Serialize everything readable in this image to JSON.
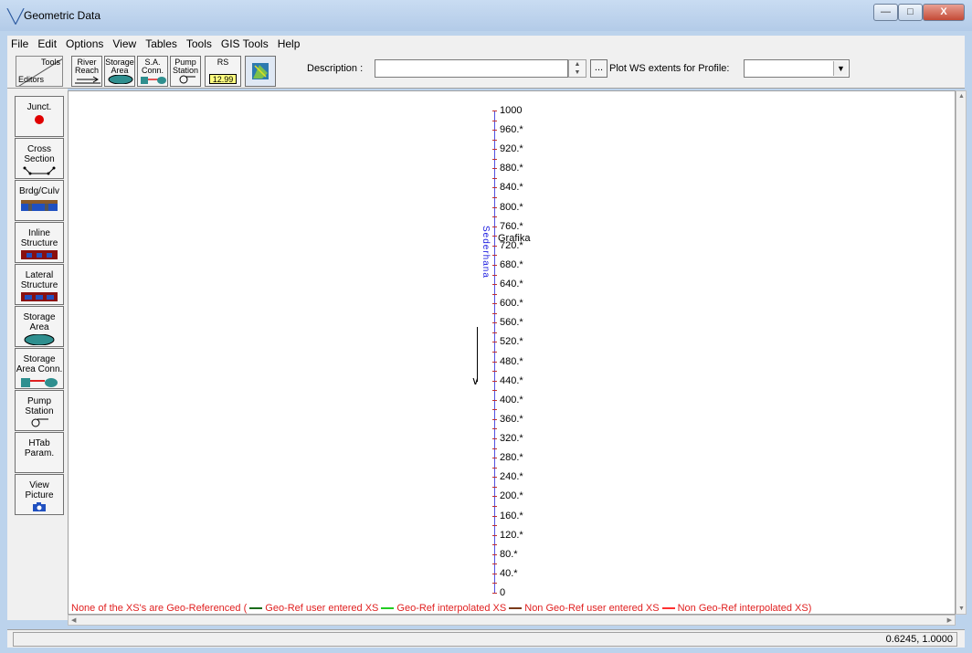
{
  "window": {
    "title": "Geometric Data",
    "app_icon": "hec-ras-icon"
  },
  "window_controls": {
    "minimize": "—",
    "maximize": "□",
    "close": "X"
  },
  "menu": [
    "File",
    "Edit",
    "Options",
    "View",
    "Tables",
    "Tools",
    "GIS Tools",
    "Help"
  ],
  "toolbar": {
    "tools_label": "Tools",
    "editors_label": "Editors",
    "river_reach": "River Reach",
    "storage_area": "Storage Area",
    "sa_conn": "S.A. Conn.",
    "pump_station": "Pump Station",
    "rs": "RS",
    "rs_value": "12.99",
    "description_label": "Description :",
    "description_value": "",
    "ellipsis": "...",
    "plot_label": "Plot WS extents for Profile:",
    "profile_value": ""
  },
  "palette": [
    {
      "label": "Junct.",
      "icon": "junction-dot-icon"
    },
    {
      "label": "Cross Section",
      "icon": "cross-section-icon"
    },
    {
      "label": "Brdg/Culv",
      "icon": "bridge-icon"
    },
    {
      "label": "Inline Structure",
      "icon": "inline-structure-icon"
    },
    {
      "label": "Lateral Structure",
      "icon": "lateral-structure-icon"
    },
    {
      "label": "Storage Area",
      "icon": "storage-area-icon"
    },
    {
      "label": "Storage Area Conn.",
      "icon": "storage-area-conn-icon"
    },
    {
      "label": "Pump Station",
      "icon": "pump-icon"
    },
    {
      "label": "HTab Param.",
      "icon": ""
    },
    {
      "label": "View Picture",
      "icon": "camera-icon"
    }
  ],
  "canvas": {
    "river_name": "Sederhana",
    "reach_name": "Grafika",
    "stations": [
      "1000",
      "960.*",
      "920.*",
      "880.*",
      "840.*",
      "800.*",
      "760.*",
      "720.*",
      "680.*",
      "640.*",
      "600.*",
      "560.*",
      "520.*",
      "480.*",
      "440.*",
      "400.*",
      "360.*",
      "320.*",
      "280.*",
      "240.*",
      "200.*",
      "160.*",
      "120.*",
      "80.*",
      "40.*",
      "0"
    ],
    "geo_message_prefix": "None of the XS's are Geo-Referenced (",
    "legend": [
      {
        "label": "Geo-Ref user entered XS",
        "color": "#1a6b1a"
      },
      {
        "label": "Geo-Ref interpolated XS",
        "color": "#22cc22"
      },
      {
        "label": "Non Geo-Ref user entered XS",
        "color": "#7a3a1a"
      },
      {
        "label": "Non Geo-Ref interpolated XS",
        "color": "#ff3030"
      }
    ],
    "geo_message_suffix": ")"
  },
  "status": {
    "coords": "0.6245, 1.0000"
  }
}
